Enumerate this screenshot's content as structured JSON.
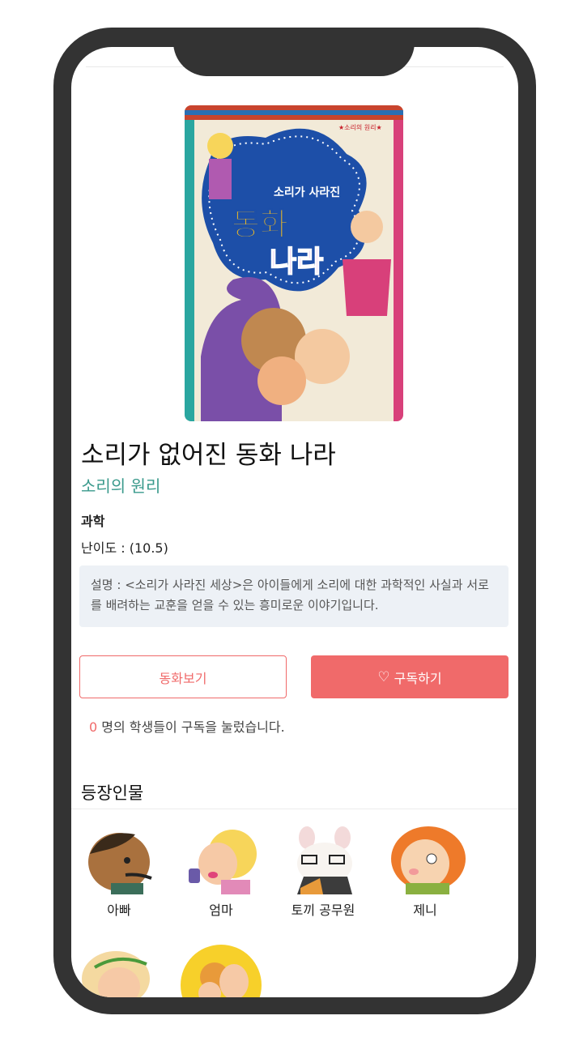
{
  "book": {
    "title": "소리가 없어진 동화 나라",
    "series": "소리의 원리",
    "category": "과학",
    "difficulty": "난이도 : (10.5)",
    "description": "설명 : <소리가 사라진 세상>은 아이들에게 소리에 대한 과학적인 사실과 서로를 배려하는 교훈을 얻을 수 있는 흥미로운 이야기입니다.",
    "cover": {
      "badge": "★소리의 원리★",
      "title_top": "소리가 사라진",
      "title_line1": "동화",
      "title_line2": "나라"
    }
  },
  "actions": {
    "view_label": "동화보기",
    "subscribe_label": "구독하기",
    "subscriber_count": "0",
    "subscriber_text": " 명의 학생들이 구독을 눌렀습니다."
  },
  "characters_section": {
    "title": "등장인물",
    "items": [
      {
        "name": "아빠"
      },
      {
        "name": "엄마"
      },
      {
        "name": "토끼 공무원"
      },
      {
        "name": "제니"
      },
      {
        "name": ""
      },
      {
        "name": ""
      }
    ]
  },
  "colors": {
    "accent": "#f06a6a",
    "series": "#3a9a8c",
    "description_bg": "#edf1f6",
    "phone_frame": "#333333"
  }
}
